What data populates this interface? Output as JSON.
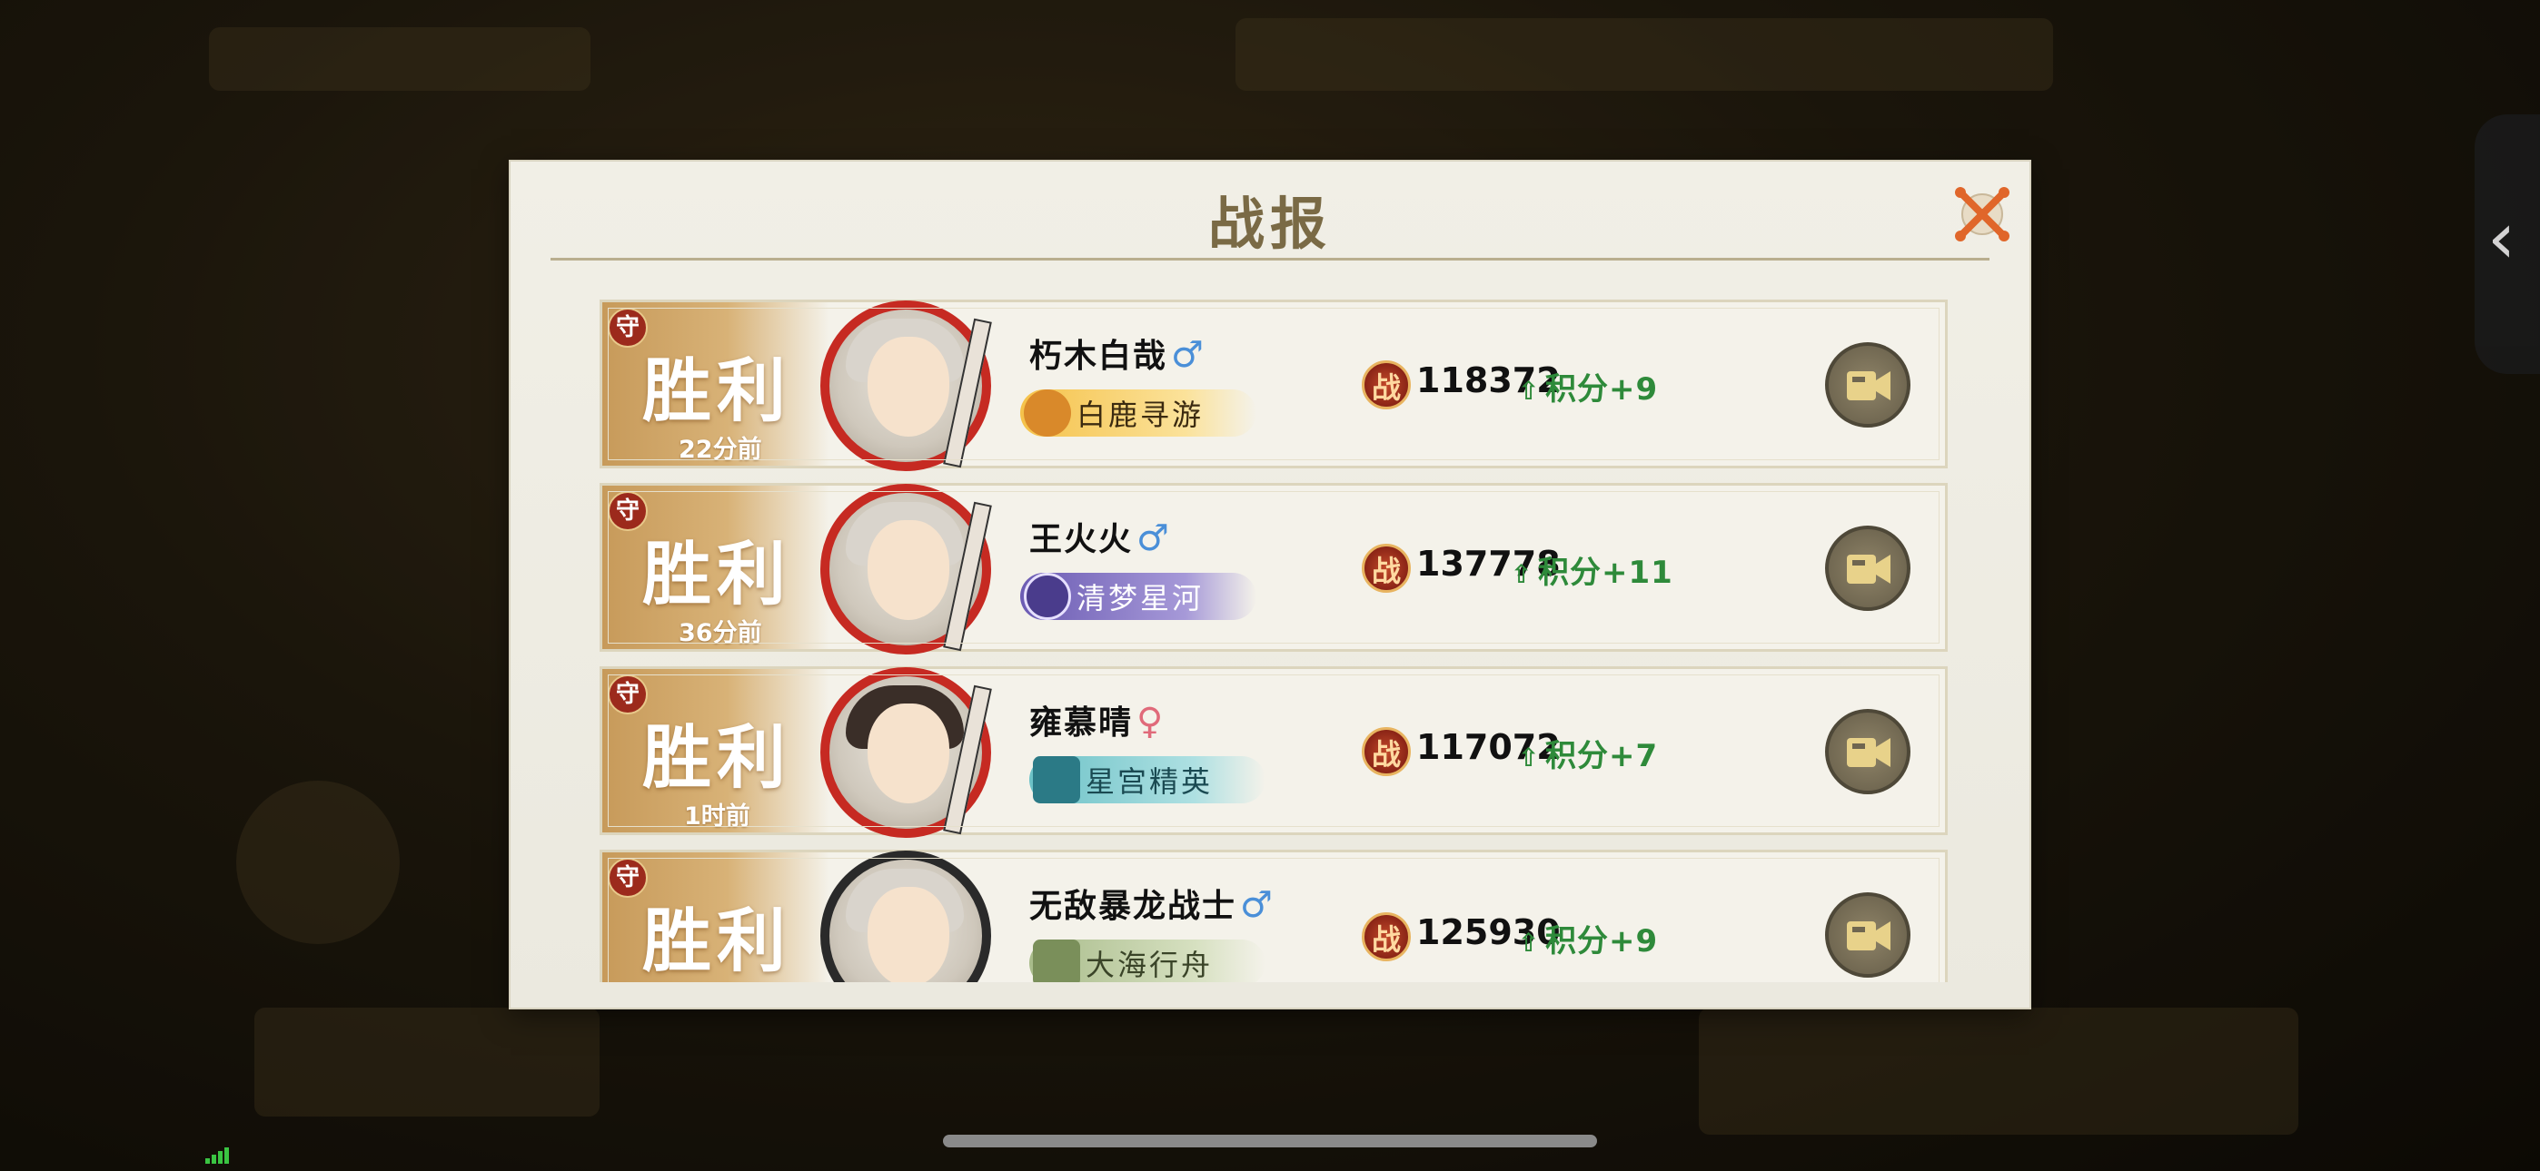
{
  "dialog": {
    "title": "战报",
    "close_icon": "close-x-icon"
  },
  "colors": {
    "victory_gold": "#d8b277",
    "defense_badge": "#9c2a1c",
    "score_green": "#2e8a3a",
    "male": "#4a8fd8",
    "female": "#e06a7a"
  },
  "records": [
    {
      "badge": "守",
      "result": "胜利",
      "time": "22分前",
      "name": "朽木白哉",
      "gender_symbol": "♂",
      "gender": "male",
      "title": "白鹿寻游",
      "title_style": "gold",
      "power_icon_label": "战",
      "power": "118372",
      "score": "积分+9"
    },
    {
      "badge": "守",
      "result": "胜利",
      "time": "36分前",
      "name": "王火火",
      "gender_symbol": "♂",
      "gender": "male",
      "title": "清梦星河",
      "title_style": "purple",
      "power_icon_label": "战",
      "power": "137778",
      "score": "积分+11"
    },
    {
      "badge": "守",
      "result": "胜利",
      "time": "1时前",
      "name": "雍慕晴",
      "gender_symbol": "♀",
      "gender": "female",
      "title": "星宫精英",
      "title_style": "teal",
      "power_icon_label": "战",
      "power": "117072",
      "score": "积分+7"
    },
    {
      "badge": "守",
      "result": "胜利",
      "time": "",
      "name": "无敌暴龙战士",
      "gender_symbol": "♂",
      "gender": "male",
      "title": "大海行舟",
      "title_style": "green",
      "power_icon_label": "战",
      "power": "125930",
      "score": "积分+9"
    }
  ]
}
